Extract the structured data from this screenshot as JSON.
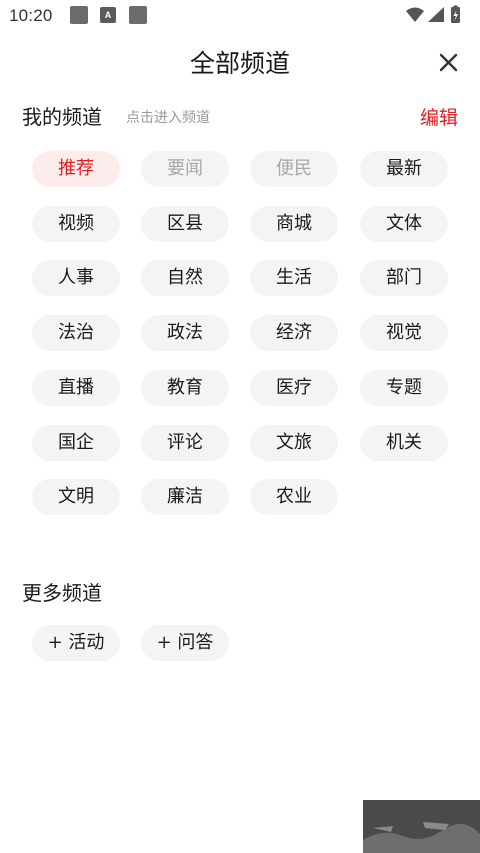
{
  "status_bar": {
    "time": "10:20",
    "notification_a_label": "A"
  },
  "header": {
    "title": "全部频道",
    "close_icon": "close-icon"
  },
  "my_channels": {
    "title": "我的频道",
    "hint": "点击进入频道",
    "edit_label": "编辑",
    "items": [
      {
        "label": "推荐",
        "state": "active"
      },
      {
        "label": "要闻",
        "state": "fixed"
      },
      {
        "label": "便民",
        "state": "fixed"
      },
      {
        "label": "最新",
        "state": "normal"
      },
      {
        "label": "视频",
        "state": "normal"
      },
      {
        "label": "区县",
        "state": "normal"
      },
      {
        "label": "商城",
        "state": "normal"
      },
      {
        "label": "文体",
        "state": "normal"
      },
      {
        "label": "人事",
        "state": "normal"
      },
      {
        "label": "自然",
        "state": "normal"
      },
      {
        "label": "生活",
        "state": "normal"
      },
      {
        "label": "部门",
        "state": "normal"
      },
      {
        "label": "法治",
        "state": "normal"
      },
      {
        "label": "政法",
        "state": "normal"
      },
      {
        "label": "经济",
        "state": "normal"
      },
      {
        "label": "视觉",
        "state": "normal"
      },
      {
        "label": "直播",
        "state": "normal"
      },
      {
        "label": "教育",
        "state": "normal"
      },
      {
        "label": "医疗",
        "state": "normal"
      },
      {
        "label": "专题",
        "state": "normal"
      },
      {
        "label": "国企",
        "state": "normal"
      },
      {
        "label": "评论",
        "state": "normal"
      },
      {
        "label": "文旅",
        "state": "normal"
      },
      {
        "label": "机关",
        "state": "normal"
      },
      {
        "label": "文明",
        "state": "normal"
      },
      {
        "label": "廉洁",
        "state": "normal"
      },
      {
        "label": "农业",
        "state": "normal"
      }
    ]
  },
  "more_channels": {
    "title": "更多频道",
    "items": [
      {
        "label": "+  活动"
      },
      {
        "label": "+  问答"
      }
    ]
  },
  "colors": {
    "accent": "#e02020",
    "active_chip_bg": "#fdecec",
    "chip_bg": "#f4f4f4",
    "fixed_text": "#a8a8a8"
  }
}
